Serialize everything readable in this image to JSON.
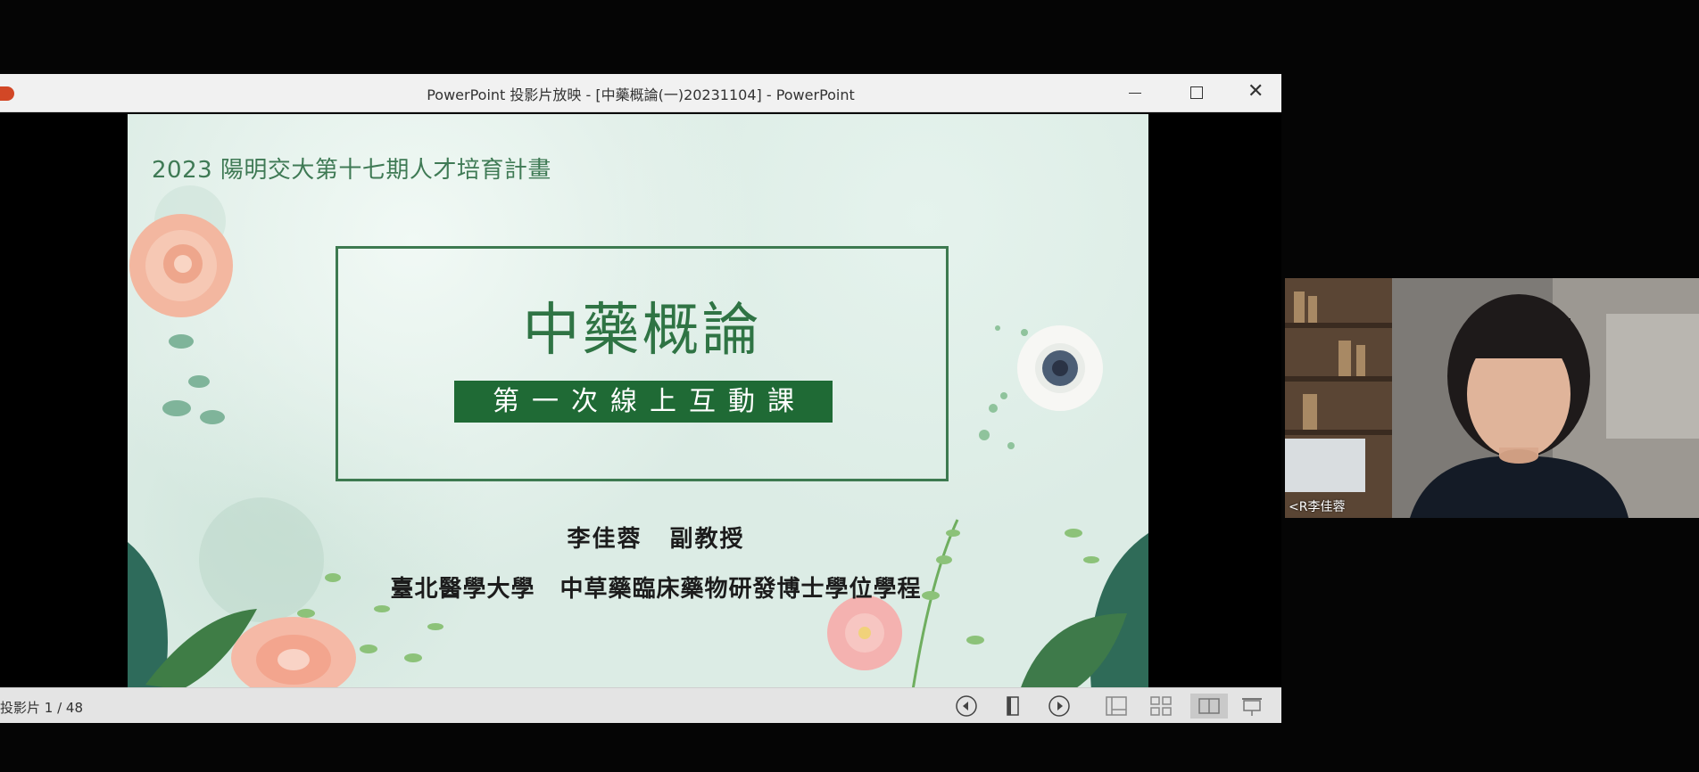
{
  "window": {
    "title": "PowerPoint 投影片放映 - [中藥概論(一)20231104] - PowerPoint",
    "controls": [
      "minimize",
      "maximize",
      "close"
    ],
    "close_glyph": "✕"
  },
  "slide": {
    "header": "2023 陽明交大第十七期人才培育計畫",
    "title": "中藥概論",
    "subtitle": "第一次線上互動課",
    "presenter": "李佳蓉 副教授",
    "affiliation": "臺北醫學大學 中草藥臨床藥物研發博士學位學程",
    "colors": {
      "accent": "#1f6a35",
      "title": "#2f7444",
      "background": "#dcece5"
    }
  },
  "statusbar": {
    "slide_counter": "投影片 1 / 48",
    "buttons": [
      "previous-slide-icon",
      "notes-icon",
      "next-slide-icon",
      "normal-view-icon",
      "slide-sorter-icon",
      "reading-view-icon",
      "slideshow-icon"
    ]
  },
  "webcam": {
    "participant_name": "<R李佳蓉"
  }
}
